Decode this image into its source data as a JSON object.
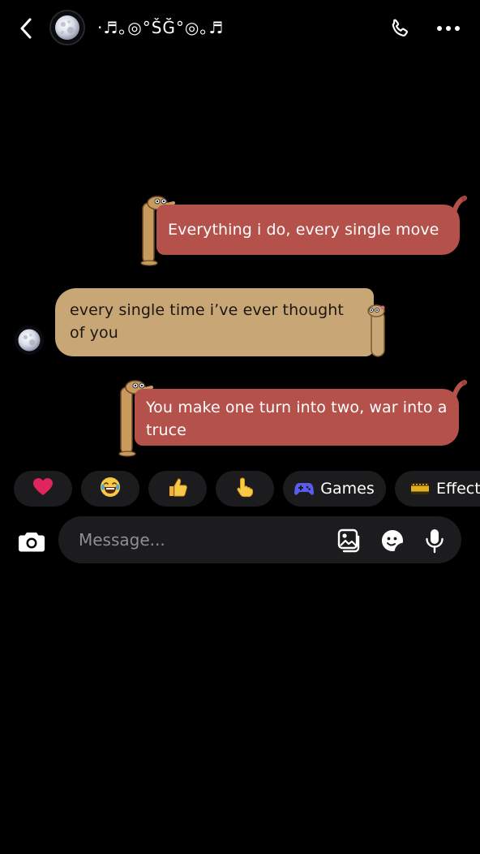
{
  "header": {
    "contact_name": "·♬｡◎°ŠĞ°◎｡♬",
    "back_icon": "chevron-left-icon",
    "call_icon": "phone-icon",
    "more_icon": "ellipsis-icon",
    "avatar": "moon-avatar"
  },
  "messages": [
    {
      "direction": "outgoing",
      "text": "Everything i do, every single move"
    },
    {
      "direction": "incoming",
      "text": "every single time i’ve ever thought of you"
    },
    {
      "direction": "outgoing",
      "text": "You make one turn into two, war into a truce"
    }
  ],
  "quick_reactions": [
    {
      "icon": "heart-emoji",
      "glyph": "❤️"
    },
    {
      "icon": "laughing-emoji",
      "glyph": "😂"
    },
    {
      "icon": "thumbs-up-emoji",
      "glyph": "👍"
    },
    {
      "icon": "pointing-hand-emoji",
      "glyph": "👆"
    },
    {
      "icon": "gamepad-icon",
      "label": "Games"
    },
    {
      "icon": "film-icon",
      "label": "Effects"
    }
  ],
  "composer": {
    "placeholder": "Message...",
    "camera_icon": "camera-icon",
    "icons": [
      "photo-icon",
      "sticker-icon",
      "microphone-icon"
    ]
  },
  "colors": {
    "background": "#000000",
    "outgoing_bubble": "#b5514b",
    "incoming_bubble": "#c9a676",
    "chip_background": "#1c1c1e",
    "placeholder_text": "#8e8e93",
    "games_icon": "#5b5bf0"
  }
}
